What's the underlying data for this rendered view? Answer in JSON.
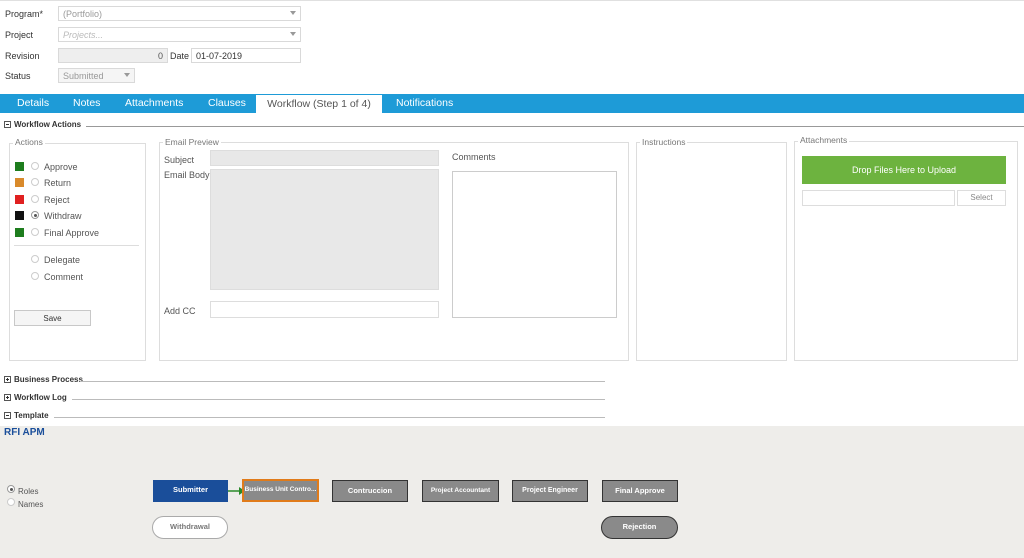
{
  "header": {
    "program_label": "Program*",
    "program_value": "(Portfolio)",
    "project_label": "Project",
    "project_placeholder": "Projects...",
    "revision_label": "Revision",
    "revision_value": "0",
    "date_label": "Date",
    "date_value": "01-07-2019",
    "status_label": "Status",
    "status_value": "Submitted"
  },
  "tabs": [
    {
      "label": "Details"
    },
    {
      "label": "Notes"
    },
    {
      "label": "Attachments"
    },
    {
      "label": "Clauses"
    },
    {
      "label": "Workflow (Step 1 of 4)",
      "active": true
    },
    {
      "label": "Notifications"
    }
  ],
  "workflow_actions": {
    "title": "Workflow Actions",
    "actions_legend": "Actions",
    "actions": [
      {
        "label": "Approve",
        "color": "#1e7d1e"
      },
      {
        "label": "Return",
        "color": "#d98a2b"
      },
      {
        "label": "Reject",
        "color": "#e02020"
      },
      {
        "label": "Withdraw",
        "color": "#111111",
        "selected": true
      },
      {
        "label": "Final Approve",
        "color": "#1e7d1e"
      }
    ],
    "extra_actions": [
      {
        "label": "Delegate"
      },
      {
        "label": "Comment"
      }
    ],
    "save_label": "Save",
    "email_preview_legend": "Email Preview",
    "subject_label": "Subject",
    "email_body_label": "Email Body",
    "add_cc_label": "Add CC",
    "comments_label": "Comments",
    "instructions_legend": "Instructions",
    "attachments_legend": "Attachments",
    "upload_label": "Drop Files Here to Upload",
    "select_label": "Select"
  },
  "sections": {
    "business_process": "Business Process",
    "workflow_log": "Workflow Log",
    "template": "Template"
  },
  "template": {
    "title": "RFI APM",
    "view_options": [
      {
        "label": "Roles",
        "selected": true
      },
      {
        "label": "Names",
        "selected": false
      }
    ],
    "steps": {
      "submitter": "Submitter",
      "business_unit": "Business Unit Contro...",
      "contruccion": "Contruccion",
      "project_accountant": "Project Accountant",
      "project_engineer": "Project Engineer",
      "final_approve": "Final Approve",
      "withdrawal": "Withdrawal",
      "rejection": "Rejection"
    }
  }
}
